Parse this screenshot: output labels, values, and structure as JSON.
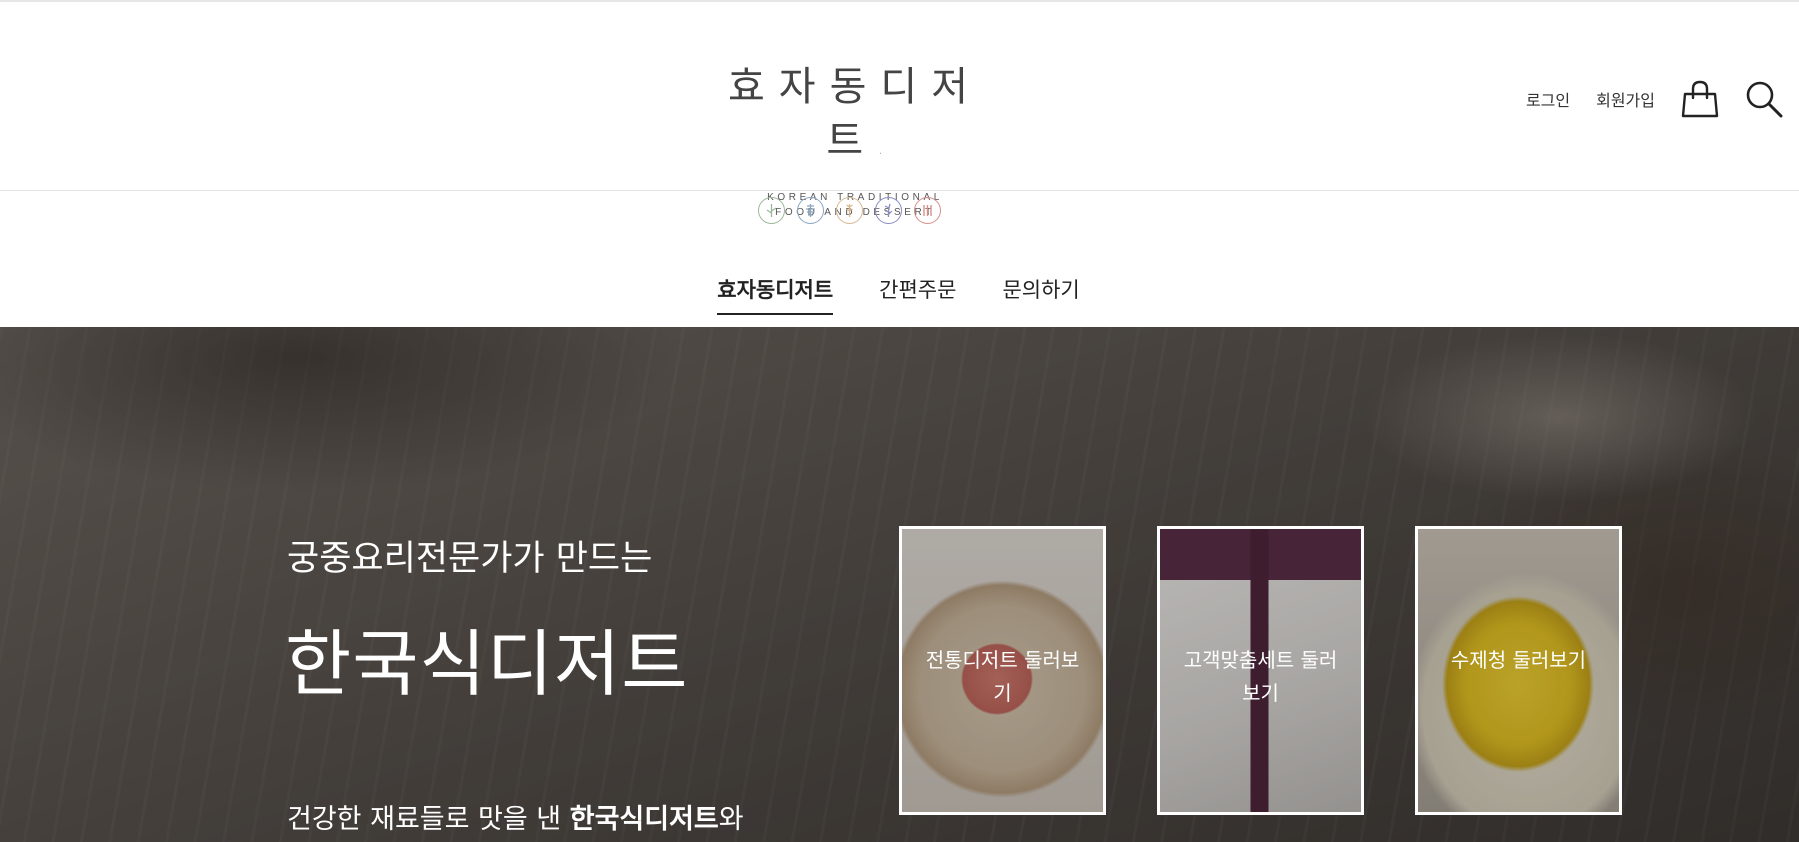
{
  "header": {
    "logo_kr": "효자동디저트",
    "logo_dot": ".",
    "logo_en_line1": "KOREAN TRADITIONAL",
    "logo_en_line2": "FOOD AND DESSERT",
    "login": "로그인",
    "signup": "회원가입",
    "cart_icon": "shopping-bag-icon",
    "search_icon": "search-icon"
  },
  "symbols": [
    {
      "icon": "leaf-symbol-icon",
      "color": "#9bb89a"
    },
    {
      "icon": "grain-symbol-icon",
      "color": "#8aa6c0"
    },
    {
      "icon": "wheat-symbol-icon",
      "color": "#d8b892"
    },
    {
      "icon": "herb-symbol-icon",
      "color": "#8a8cc0"
    },
    {
      "icon": "bars-symbol-icon",
      "color": "#d8908a"
    }
  ],
  "nav": {
    "items": [
      {
        "label": "효자동디저트",
        "active": true
      },
      {
        "label": "간편주문",
        "active": false
      },
      {
        "label": "문의하기",
        "active": false
      }
    ]
  },
  "hero": {
    "subtitle": "궁중요리전문가가 만드는",
    "title": "한국식디저트",
    "desc_prefix": "건강한 재료들로 맛을 낸 ",
    "desc_bold": "한국식디저트",
    "desc_suffix": "와",
    "cards": [
      {
        "label": "전통디저트 둘러보기"
      },
      {
        "label": "고객맞춤세트 둘러보기"
      },
      {
        "label": "수제청 둘러보기"
      }
    ]
  }
}
